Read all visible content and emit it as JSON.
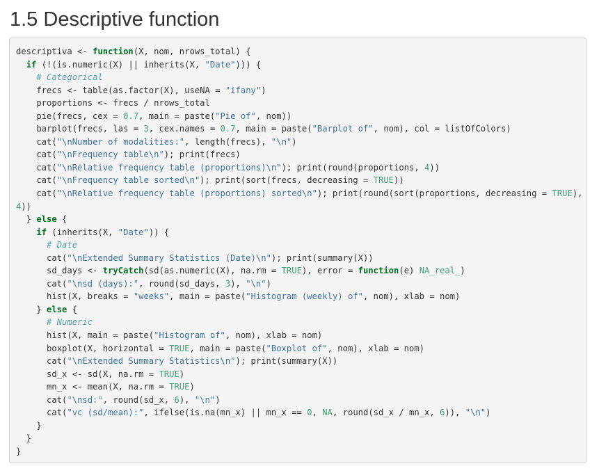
{
  "heading": {
    "title": "1.5 Descriptive function"
  },
  "colors": {
    "keyword": "#007020",
    "string": "#4070a0",
    "number": "#40a070",
    "comment": "#60a0b0",
    "panel_background": "#f5f5f5",
    "panel_border": "#cccccc"
  },
  "code": {
    "language": "r",
    "lines": [
      [
        [
          "descriptiva <- ",
          "def"
        ],
        [
          "function",
          "kw"
        ],
        [
          "(X, nom, nrows_total) {",
          "def"
        ]
      ],
      [
        [
          "  ",
          "def"
        ],
        [
          "if",
          "kw"
        ],
        [
          " (!(is.numeric(X) || inherits(X, ",
          "def"
        ],
        [
          "\"Date\"",
          "str"
        ],
        [
          "))) {",
          "def"
        ]
      ],
      [
        [
          "    ",
          "def"
        ],
        [
          "# Categorical",
          "com"
        ]
      ],
      [
        [
          "    frecs <- table(as.factor(X), useNA = ",
          "def"
        ],
        [
          "\"ifany\"",
          "str"
        ],
        [
          ")",
          "def"
        ]
      ],
      [
        [
          "    proportions <- frecs / nrows_total",
          "def"
        ]
      ],
      [
        [
          "    pie(frecs, cex = ",
          "def"
        ],
        [
          "0.7",
          "num"
        ],
        [
          ", main = paste(",
          "def"
        ],
        [
          "\"Pie of\"",
          "str"
        ],
        [
          ", nom))",
          "def"
        ]
      ],
      [
        [
          "    barplot(frecs, las = ",
          "def"
        ],
        [
          "3",
          "num"
        ],
        [
          ", cex.names = ",
          "def"
        ],
        [
          "0.7",
          "num"
        ],
        [
          ", main = paste(",
          "def"
        ],
        [
          "\"Barplot of\"",
          "str"
        ],
        [
          ", nom), col = listOfColors)",
          "def"
        ]
      ],
      [
        [
          "    cat(",
          "def"
        ],
        [
          "\"\\nNumber of modalities:\"",
          "str"
        ],
        [
          ", length(frecs), ",
          "def"
        ],
        [
          "\"\\n\"",
          "str"
        ],
        [
          ")",
          "def"
        ]
      ],
      [
        [
          "    cat(",
          "def"
        ],
        [
          "\"\\nFrequency table\\n\"",
          "str"
        ],
        [
          "); print(frecs)",
          "def"
        ]
      ],
      [
        [
          "    cat(",
          "def"
        ],
        [
          "\"\\nRelative frequency table (proportions)\\n\"",
          "str"
        ],
        [
          "); print(round(proportions, ",
          "def"
        ],
        [
          "4",
          "num"
        ],
        [
          "))",
          "def"
        ]
      ],
      [
        [
          "    cat(",
          "def"
        ],
        [
          "\"\\nFrequency table sorted\\n\"",
          "str"
        ],
        [
          "); print(sort(frecs, decreasing = ",
          "def"
        ],
        [
          "TRUE",
          "num"
        ],
        [
          "))",
          "def"
        ]
      ],
      [
        [
          "    cat(",
          "def"
        ],
        [
          "\"\\nRelative frequency table (proportions) sorted\\n\"",
          "str"
        ],
        [
          "); print(round(sort(proportions, decreasing = ",
          "def"
        ],
        [
          "TRUE",
          "num"
        ],
        [
          "),",
          "def"
        ]
      ],
      [
        [
          "4",
          "num"
        ],
        [
          "))",
          "def"
        ]
      ],
      [
        [
          "  } ",
          "def"
        ],
        [
          "else",
          "kw"
        ],
        [
          " {",
          "def"
        ]
      ],
      [
        [
          "    ",
          "def"
        ],
        [
          "if",
          "kw"
        ],
        [
          " (inherits(X, ",
          "def"
        ],
        [
          "\"Date\"",
          "str"
        ],
        [
          ")) {",
          "def"
        ]
      ],
      [
        [
          "      ",
          "def"
        ],
        [
          "# Date",
          "com"
        ]
      ],
      [
        [
          "      cat(",
          "def"
        ],
        [
          "\"\\nExtended Summary Statistics (Date)\\n\"",
          "str"
        ],
        [
          "); print(summary(X))",
          "def"
        ]
      ],
      [
        [
          "      sd_days <- ",
          "def"
        ],
        [
          "tryCatch",
          "kw"
        ],
        [
          "(sd(as.numeric(X), na.rm = ",
          "def"
        ],
        [
          "TRUE",
          "num"
        ],
        [
          "), error = ",
          "def"
        ],
        [
          "function",
          "kw"
        ],
        [
          "(e) ",
          "def"
        ],
        [
          "NA_real_",
          "num"
        ],
        [
          ")",
          "def"
        ]
      ],
      [
        [
          "      cat(",
          "def"
        ],
        [
          "\"\\nsd (days):\"",
          "str"
        ],
        [
          ", round(sd_days, ",
          "def"
        ],
        [
          "3",
          "num"
        ],
        [
          "), ",
          "def"
        ],
        [
          "\"\\n\"",
          "str"
        ],
        [
          ")",
          "def"
        ]
      ],
      [
        [
          "      hist(X, breaks = ",
          "def"
        ],
        [
          "\"weeks\"",
          "str"
        ],
        [
          ", main = paste(",
          "def"
        ],
        [
          "\"Histogram (weekly) of\"",
          "str"
        ],
        [
          ", nom), xlab = nom)",
          "def"
        ]
      ],
      [
        [
          "    } ",
          "def"
        ],
        [
          "else",
          "kw"
        ],
        [
          " {",
          "def"
        ]
      ],
      [
        [
          "      ",
          "def"
        ],
        [
          "# Numeric",
          "com"
        ]
      ],
      [
        [
          "      hist(X, main = paste(",
          "def"
        ],
        [
          "\"Histogram of\"",
          "str"
        ],
        [
          ", nom), xlab = nom)",
          "def"
        ]
      ],
      [
        [
          "      boxplot(X, horizontal = ",
          "def"
        ],
        [
          "TRUE",
          "num"
        ],
        [
          ", main = paste(",
          "def"
        ],
        [
          "\"Boxplot of\"",
          "str"
        ],
        [
          ", nom), xlab = nom)",
          "def"
        ]
      ],
      [
        [
          "      cat(",
          "def"
        ],
        [
          "\"\\nExtended Summary Statistics\\n\"",
          "str"
        ],
        [
          "); print(summary(X))",
          "def"
        ]
      ],
      [
        [
          "      sd_x <- sd(X, na.rm = ",
          "def"
        ],
        [
          "TRUE",
          "num"
        ],
        [
          ")",
          "def"
        ]
      ],
      [
        [
          "      mn_x <- mean(X, na.rm = ",
          "def"
        ],
        [
          "TRUE",
          "num"
        ],
        [
          ")",
          "def"
        ]
      ],
      [
        [
          "      cat(",
          "def"
        ],
        [
          "\"\\nsd:\"",
          "str"
        ],
        [
          ", round(sd_x, ",
          "def"
        ],
        [
          "6",
          "num"
        ],
        [
          "), ",
          "def"
        ],
        [
          "\"\\n\"",
          "str"
        ],
        [
          ")",
          "def"
        ]
      ],
      [
        [
          "      cat(",
          "def"
        ],
        [
          "\"vc (sd/mean):\"",
          "str"
        ],
        [
          ", ifelse(is.na(mn_x) || mn_x == ",
          "def"
        ],
        [
          "0",
          "num"
        ],
        [
          ", ",
          "def"
        ],
        [
          "NA",
          "num"
        ],
        [
          ", round(sd_x / mn_x, ",
          "def"
        ],
        [
          "6",
          "num"
        ],
        [
          ")), ",
          "def"
        ],
        [
          "\"\\n\"",
          "str"
        ],
        [
          ")",
          "def"
        ]
      ],
      [
        [
          "    }",
          "def"
        ]
      ],
      [
        [
          "  }",
          "def"
        ]
      ],
      [
        [
          "}",
          "def"
        ]
      ]
    ]
  }
}
